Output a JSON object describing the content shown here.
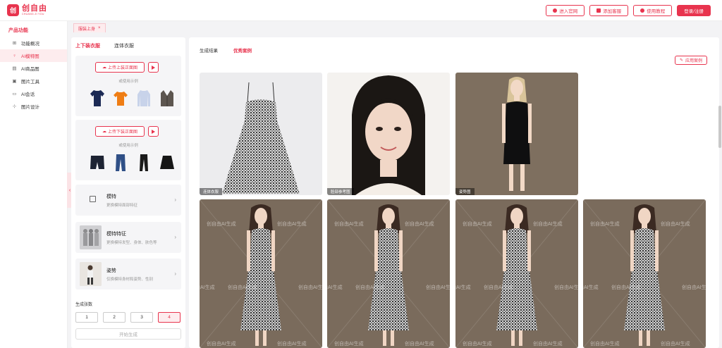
{
  "app": {
    "logo_mark": "创",
    "title": "创自由",
    "subtitle": "CHUANG ZI YOU"
  },
  "header": {
    "buttons": [
      {
        "label": "进入官网",
        "icon": "globe-icon"
      },
      {
        "label": "添加客服",
        "icon": "service-icon"
      },
      {
        "label": "使用教程",
        "icon": "help-icon"
      }
    ],
    "login_label": "登录/注册"
  },
  "sidebar": {
    "title": "产品功能",
    "items": [
      {
        "label": "功能概况",
        "icon": "grid-icon",
        "glyph": "⊞"
      },
      {
        "label": "AI模特图",
        "icon": "model-icon",
        "glyph": "♀",
        "active": true
      },
      {
        "label": "AI商品图",
        "icon": "product-icon",
        "glyph": "▤"
      },
      {
        "label": "图片工具",
        "icon": "image-tool-icon",
        "glyph": "▣"
      },
      {
        "label": "AI会话",
        "icon": "chat-icon",
        "glyph": "▭"
      },
      {
        "label": "图片设计",
        "icon": "design-icon",
        "glyph": "⊹"
      }
    ]
  },
  "tabs": [
    {
      "label": "服装上身",
      "close": "×"
    }
  ],
  "left_panel": {
    "tabs": [
      "上下装衣服",
      "连体衣服"
    ],
    "upload_top": {
      "label": "上传上装正面图",
      "example": "或使用示例"
    },
    "upload_bottom": {
      "label": "上传下装正面图",
      "example": "或使用示例"
    },
    "options": [
      {
        "title": "模特",
        "desc": "更换模特面部特征"
      },
      {
        "title": "模特特征",
        "desc": "更换模特发型、身体、肤色等"
      },
      {
        "title": "姿势",
        "desc": "仅换模特身材和姿势、性别"
      }
    ],
    "count_label": "生成张数",
    "counts": [
      "1",
      "2",
      "3",
      "4"
    ],
    "selected_count": "4",
    "generate_label": "开始生成"
  },
  "main": {
    "tabs": [
      "生成结果",
      "优秀案例"
    ],
    "active_tab": "优秀案例",
    "apply_label": "应用案例",
    "inputs": [
      {
        "caption": "连体衣服"
      },
      {
        "caption": "脸部参考图"
      },
      {
        "caption": "姿势图"
      }
    ],
    "watermark": "创自由AI生成"
  },
  "colors": {
    "accent": "#e8344e",
    "accent_light": "#fdecee"
  }
}
